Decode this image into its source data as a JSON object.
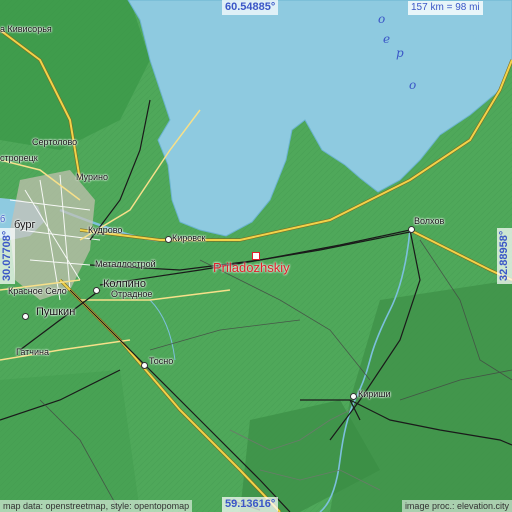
{
  "map": {
    "place_name": "Priladozhskiy",
    "lat_top": "60.54885°",
    "lat_bottom": "59.13616°",
    "lon_left": "30.07708°",
    "lon_right": "32.88958°",
    "scale_label": "157 km = 98 mi",
    "attribution_left": "map data: openstreetmap, style: opentopomap",
    "attribution_right": "image proc.: elevation.city",
    "colors": {
      "water": "#8ecae0",
      "land": "#4fa85a",
      "highlands": "#3f8f4a",
      "road_major": "#f1d34a",
      "marker": "#e0202a"
    },
    "lake_letters": [
      "о",
      "е",
      "р",
      "о"
    ],
    "towns": [
      {
        "id": "kivisorya",
        "name": "а Кивисорья"
      },
      {
        "id": "sertolovo",
        "name": "Сертолово"
      },
      {
        "id": "sestroretsk",
        "name": "строрецк"
      },
      {
        "id": "murino",
        "name": "Мурино"
      },
      {
        "id": "spb",
        "name": "бург"
      },
      {
        "id": "kudrovo",
        "name": "Кудрово"
      },
      {
        "id": "kirovsk",
        "name": "Кировск"
      },
      {
        "id": "metallostroy",
        "name": "Металлострой"
      },
      {
        "id": "kolpino",
        "name": "Колпино"
      },
      {
        "id": "otradnoe",
        "name": "Отрадное"
      },
      {
        "id": "krasnoe",
        "name": "Красное Село"
      },
      {
        "id": "pushkin",
        "name": "Пушкин"
      },
      {
        "id": "gatchina",
        "name": "Гатчина"
      },
      {
        "id": "tosno",
        "name": "Тосно"
      },
      {
        "id": "volkhov",
        "name": "Волхов"
      },
      {
        "id": "kirishi",
        "name": "Кириши"
      },
      {
        "id": "b_fragment",
        "name": "б"
      }
    ]
  }
}
